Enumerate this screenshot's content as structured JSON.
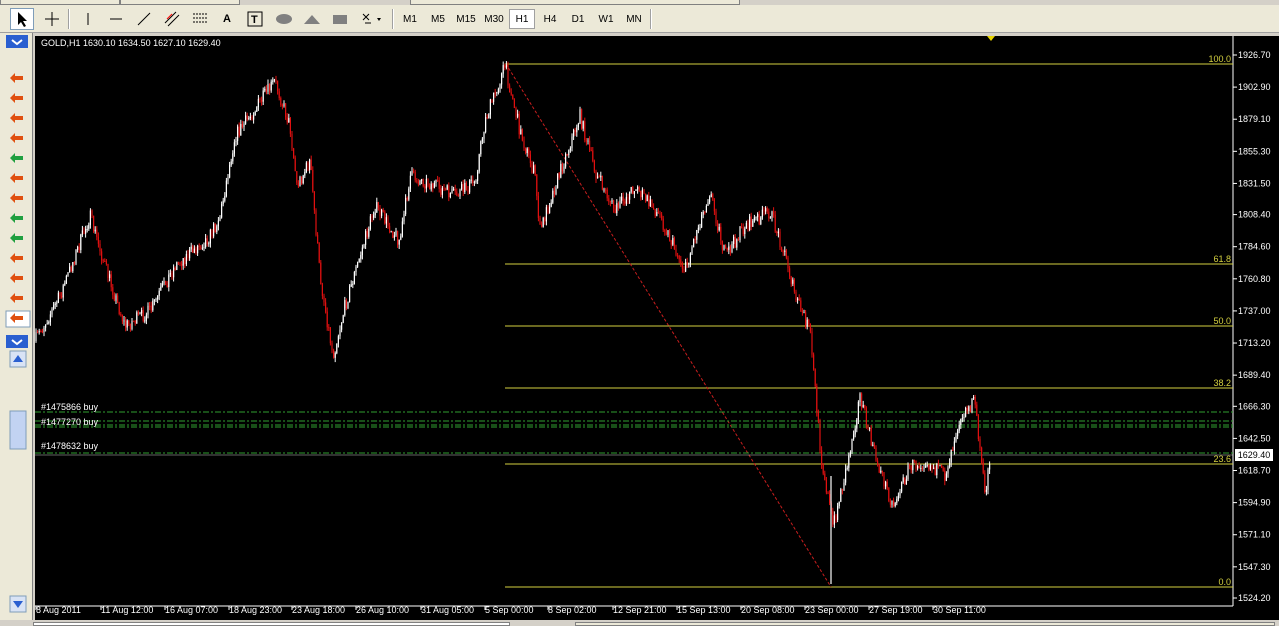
{
  "toolbar": {
    "timeframes": [
      "M1",
      "M5",
      "M15",
      "M30",
      "H1",
      "H4",
      "D1",
      "W1",
      "MN"
    ],
    "active_timeframe": "H1"
  },
  "chart": {
    "symbol_info": "GOLD,H1  1630.10 1634.50 1627.10 1629.40",
    "current_price": "1629.40",
    "price_labels": [
      "1926.70",
      "1902.90",
      "1879.10",
      "1855.30",
      "1831.50",
      "1808.40",
      "1784.60",
      "1760.80",
      "1737.00",
      "1713.20",
      "1689.40",
      "1666.30",
      "1642.50",
      "1618.70",
      "1594.90",
      "1571.10",
      "1547.30",
      "1524.20"
    ],
    "time_labels": [
      "8 Aug 2011",
      "11 Aug 12:00",
      "16 Aug 07:00",
      "18 Aug 23:00",
      "23 Aug 18:00",
      "26 Aug 10:00",
      "31 Aug 05:00",
      "5 Sep 00:00",
      "8 Sep 02:00",
      "12 Sep 21:00",
      "15 Sep 13:00",
      "20 Sep 08:00",
      "23 Sep 00:00",
      "27 Sep 19:00",
      "30 Sep 11:00"
    ],
    "fib_levels": [
      "100.0",
      "61.8",
      "50.0",
      "38.2",
      "23.6",
      "0.0"
    ],
    "orders": [
      "#1475866 buy",
      "#1477270 buy",
      "#1478632 buy"
    ],
    "colors": {
      "background": "#000000",
      "fib": "#d4d040",
      "order_line": "#2f9e2f",
      "trend": "#c81e1e",
      "candle_up": "#ffffff",
      "candle_down": "#e01010",
      "text": "#ffffff"
    }
  }
}
